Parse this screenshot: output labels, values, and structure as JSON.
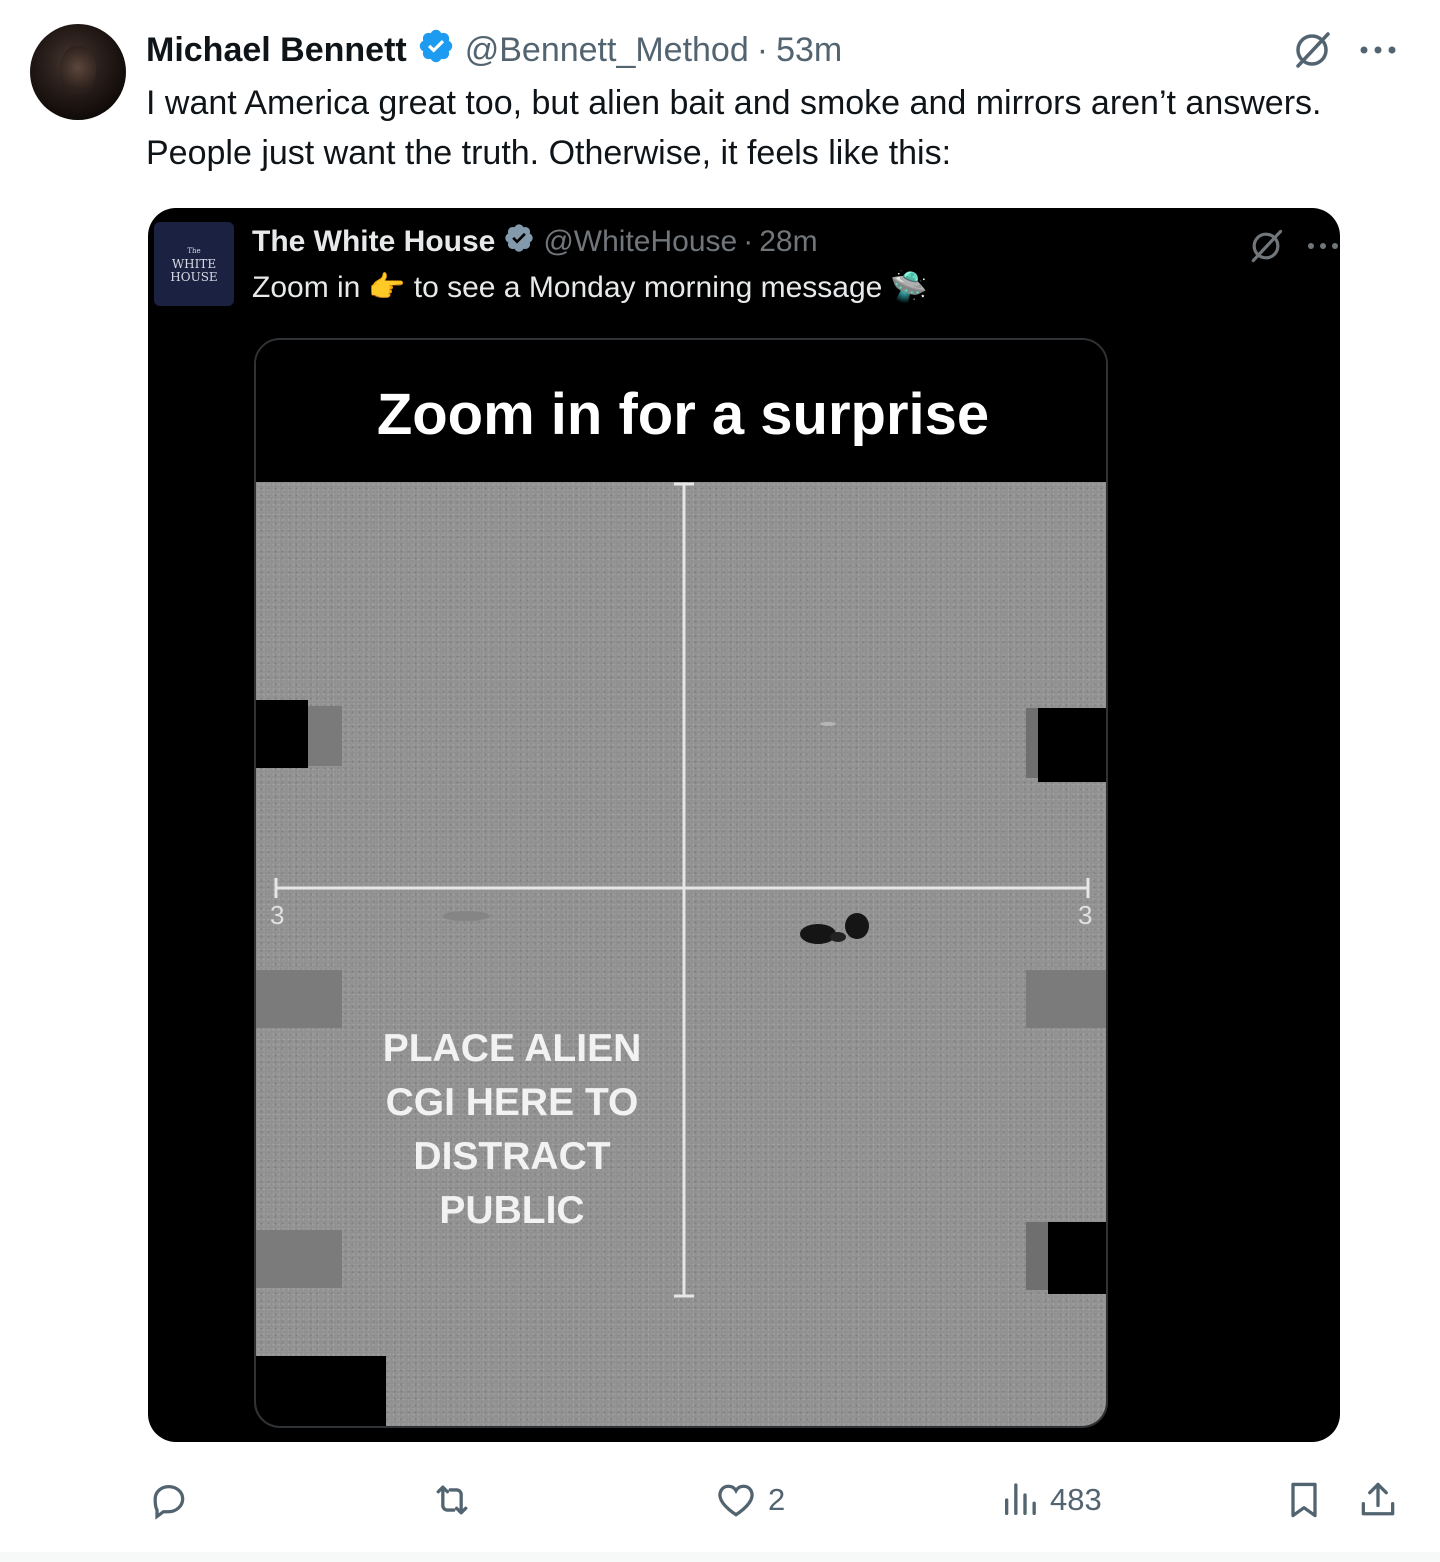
{
  "post": {
    "author_name": "Michael Bennett",
    "author_handle": "@Bennett_Method",
    "separator": "·",
    "time": "53m",
    "text": "I want America great too, but alien bait and smoke and mirrors aren’t answers. People just want the truth. Otherwise, it feels like this:",
    "icons": [
      "verified-badge-icon",
      "grok-icon",
      "more-icon"
    ]
  },
  "quoted": {
    "avatar_text": [
      "The",
      "WHITE",
      "HOUSE"
    ],
    "author_name": "The White House",
    "author_handle": "@WhiteHouse",
    "separator": "·",
    "time": "28m",
    "text_before": "Zoom in",
    "text_after": "to see a Monday morning message",
    "emoji_1": "👉",
    "emoji_2": "🛸",
    "image": {
      "banner": "Zoom in for a surprise",
      "axis_label_left": "3",
      "axis_label_right": "3",
      "overlay_text": "PLACE ALIEN CGI HERE TO DISTRACT PUBLIC"
    }
  },
  "actions": {
    "reply_count": "",
    "retweet_count": "",
    "like_count": "2",
    "views_count": "483",
    "colors": {
      "icon": "#536471",
      "verified": "#1d9bf0"
    }
  }
}
